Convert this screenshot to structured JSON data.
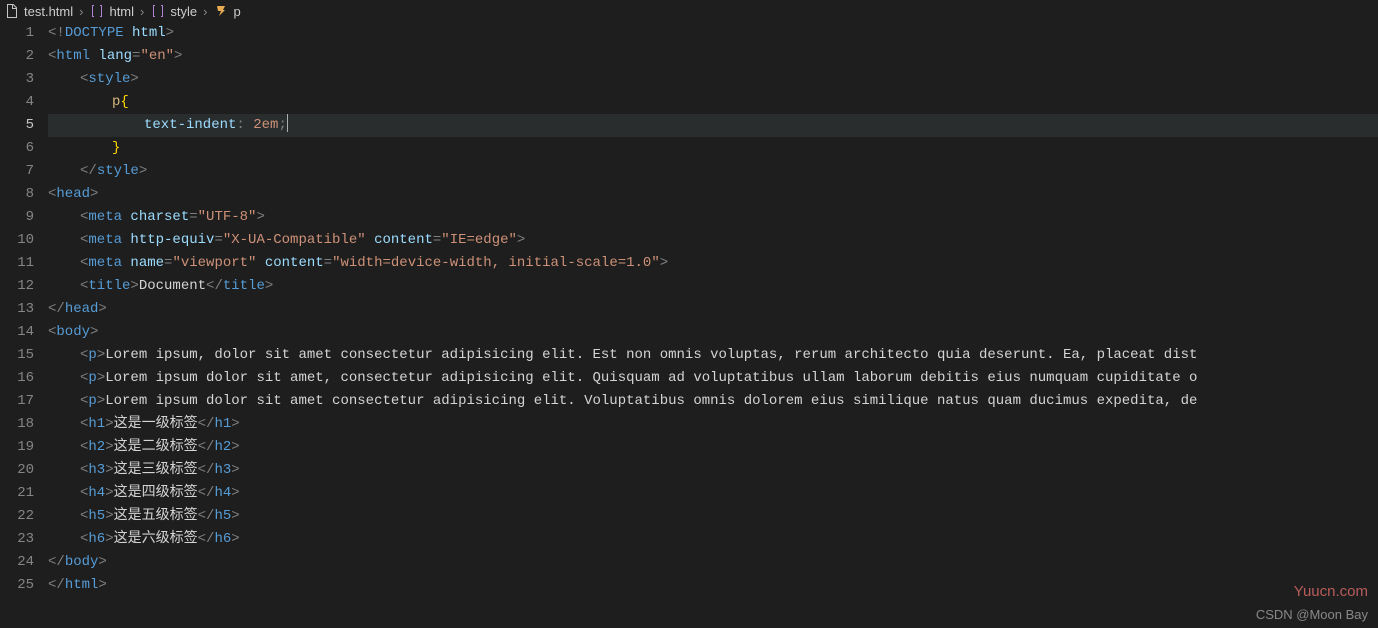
{
  "breadcrumb": [
    {
      "icon": "file",
      "label": "test.html"
    },
    {
      "icon": "brackets",
      "label": "html"
    },
    {
      "icon": "brackets",
      "label": "style"
    },
    {
      "icon": "symbol",
      "label": "p"
    }
  ],
  "activeLine": 5,
  "lines": [
    {
      "n": 1,
      "indent": 0,
      "seg": [
        [
          "c-gray",
          "<!"
        ],
        [
          "c-tag",
          "DOCTYPE"
        ],
        [
          "c-attr",
          " html"
        ],
        [
          "c-gray",
          ">"
        ]
      ]
    },
    {
      "n": 2,
      "indent": 0,
      "seg": [
        [
          "c-gray",
          "<"
        ],
        [
          "c-tag",
          "html"
        ],
        [
          "c-attr",
          " lang"
        ],
        [
          "c-gray",
          "="
        ],
        [
          "c-str",
          "\"en\""
        ],
        [
          "c-gray",
          ">"
        ]
      ]
    },
    {
      "n": 3,
      "indent": 1,
      "seg": [
        [
          "c-gray",
          "<"
        ],
        [
          "c-tag",
          "style"
        ],
        [
          "c-gray",
          ">"
        ]
      ]
    },
    {
      "n": 4,
      "indent": 2,
      "seg": [
        [
          "c-sel",
          "p"
        ],
        [
          "c-brace",
          "{"
        ]
      ]
    },
    {
      "n": 5,
      "indent": 3,
      "hl": true,
      "seg": [
        [
          "c-prop",
          "text-indent"
        ],
        [
          "c-gray",
          ": "
        ],
        [
          "c-val",
          "2em"
        ],
        [
          "c-gray",
          ";"
        ]
      ],
      "cursor": true
    },
    {
      "n": 6,
      "indent": 2,
      "seg": [
        [
          "c-brace",
          "}"
        ]
      ]
    },
    {
      "n": 7,
      "indent": 1,
      "seg": [
        [
          "c-gray",
          "</"
        ],
        [
          "c-tag",
          "style"
        ],
        [
          "c-gray",
          ">"
        ]
      ]
    },
    {
      "n": 8,
      "indent": 0,
      "seg": [
        [
          "c-gray",
          "<"
        ],
        [
          "c-tag",
          "head"
        ],
        [
          "c-gray",
          ">"
        ]
      ]
    },
    {
      "n": 9,
      "indent": 1,
      "seg": [
        [
          "c-gray",
          "<"
        ],
        [
          "c-tag",
          "meta"
        ],
        [
          "c-attr",
          " charset"
        ],
        [
          "c-gray",
          "="
        ],
        [
          "c-str",
          "\"UTF-8\""
        ],
        [
          "c-gray",
          ">"
        ]
      ]
    },
    {
      "n": 10,
      "indent": 1,
      "seg": [
        [
          "c-gray",
          "<"
        ],
        [
          "c-tag",
          "meta"
        ],
        [
          "c-attr",
          " http-equiv"
        ],
        [
          "c-gray",
          "="
        ],
        [
          "c-str",
          "\"X-UA-Compatible\""
        ],
        [
          "c-attr",
          " content"
        ],
        [
          "c-gray",
          "="
        ],
        [
          "c-str",
          "\"IE=edge\""
        ],
        [
          "c-gray",
          ">"
        ]
      ]
    },
    {
      "n": 11,
      "indent": 1,
      "seg": [
        [
          "c-gray",
          "<"
        ],
        [
          "c-tag",
          "meta"
        ],
        [
          "c-attr",
          " name"
        ],
        [
          "c-gray",
          "="
        ],
        [
          "c-str",
          "\"viewport\""
        ],
        [
          "c-attr",
          " content"
        ],
        [
          "c-gray",
          "="
        ],
        [
          "c-str",
          "\"width=device-width, initial-scale=1.0\""
        ],
        [
          "c-gray",
          ">"
        ]
      ]
    },
    {
      "n": 12,
      "indent": 1,
      "seg": [
        [
          "c-gray",
          "<"
        ],
        [
          "c-tag",
          "title"
        ],
        [
          "c-gray",
          ">"
        ],
        [
          "c-text",
          "Document"
        ],
        [
          "c-gray",
          "</"
        ],
        [
          "c-tag",
          "title"
        ],
        [
          "c-gray",
          ">"
        ]
      ]
    },
    {
      "n": 13,
      "indent": 0,
      "seg": [
        [
          "c-gray",
          "</"
        ],
        [
          "c-tag",
          "head"
        ],
        [
          "c-gray",
          ">"
        ]
      ]
    },
    {
      "n": 14,
      "indent": 0,
      "seg": [
        [
          "c-gray",
          "<"
        ],
        [
          "c-tag",
          "body"
        ],
        [
          "c-gray",
          ">"
        ]
      ]
    },
    {
      "n": 15,
      "indent": 1,
      "seg": [
        [
          "c-gray",
          "<"
        ],
        [
          "c-tag",
          "p"
        ],
        [
          "c-gray",
          ">"
        ],
        [
          "c-text",
          "Lorem ipsum, dolor sit amet consectetur adipisicing elit. Est non omnis voluptas, rerum architecto quia deserunt. Ea, placeat dist"
        ]
      ]
    },
    {
      "n": 16,
      "indent": 1,
      "seg": [
        [
          "c-gray",
          "<"
        ],
        [
          "c-tag",
          "p"
        ],
        [
          "c-gray",
          ">"
        ],
        [
          "c-text",
          "Lorem ipsum dolor sit amet, consectetur adipisicing elit. Quisquam ad voluptatibus ullam laborum debitis eius numquam cupiditate o"
        ]
      ]
    },
    {
      "n": 17,
      "indent": 1,
      "seg": [
        [
          "c-gray",
          "<"
        ],
        [
          "c-tag",
          "p"
        ],
        [
          "c-gray",
          ">"
        ],
        [
          "c-text",
          "Lorem ipsum dolor sit amet consectetur adipisicing elit. Voluptatibus omnis dolorem eius similique natus quam ducimus expedita, de"
        ]
      ]
    },
    {
      "n": 18,
      "indent": 1,
      "seg": [
        [
          "c-gray",
          "<"
        ],
        [
          "c-tag",
          "h1"
        ],
        [
          "c-gray",
          ">"
        ],
        [
          "c-text",
          "这是一级标签"
        ],
        [
          "c-gray",
          "</"
        ],
        [
          "c-tag",
          "h1"
        ],
        [
          "c-gray",
          ">"
        ]
      ]
    },
    {
      "n": 19,
      "indent": 1,
      "seg": [
        [
          "c-gray",
          "<"
        ],
        [
          "c-tag",
          "h2"
        ],
        [
          "c-gray",
          ">"
        ],
        [
          "c-text",
          "这是二级标签"
        ],
        [
          "c-gray",
          "</"
        ],
        [
          "c-tag",
          "h2"
        ],
        [
          "c-gray",
          ">"
        ]
      ]
    },
    {
      "n": 20,
      "indent": 1,
      "seg": [
        [
          "c-gray",
          "<"
        ],
        [
          "c-tag",
          "h3"
        ],
        [
          "c-gray",
          ">"
        ],
        [
          "c-text",
          "这是三级标签"
        ],
        [
          "c-gray",
          "</"
        ],
        [
          "c-tag",
          "h3"
        ],
        [
          "c-gray",
          ">"
        ]
      ]
    },
    {
      "n": 21,
      "indent": 1,
      "seg": [
        [
          "c-gray",
          "<"
        ],
        [
          "c-tag",
          "h4"
        ],
        [
          "c-gray",
          ">"
        ],
        [
          "c-text",
          "这是四级标签"
        ],
        [
          "c-gray",
          "</"
        ],
        [
          "c-tag",
          "h4"
        ],
        [
          "c-gray",
          ">"
        ]
      ]
    },
    {
      "n": 22,
      "indent": 1,
      "seg": [
        [
          "c-gray",
          "<"
        ],
        [
          "c-tag",
          "h5"
        ],
        [
          "c-gray",
          ">"
        ],
        [
          "c-text",
          "这是五级标签"
        ],
        [
          "c-gray",
          "</"
        ],
        [
          "c-tag",
          "h5"
        ],
        [
          "c-gray",
          ">"
        ]
      ]
    },
    {
      "n": 23,
      "indent": 1,
      "seg": [
        [
          "c-gray",
          "<"
        ],
        [
          "c-tag",
          "h6"
        ],
        [
          "c-gray",
          ">"
        ],
        [
          "c-text",
          "这是六级标签"
        ],
        [
          "c-gray",
          "</"
        ],
        [
          "c-tag",
          "h6"
        ],
        [
          "c-gray",
          ">"
        ]
      ]
    },
    {
      "n": 24,
      "indent": 0,
      "seg": [
        [
          "c-gray",
          "</"
        ],
        [
          "c-tag",
          "body"
        ],
        [
          "c-gray",
          ">"
        ]
      ]
    },
    {
      "n": 25,
      "indent": 0,
      "seg": [
        [
          "c-gray",
          "</"
        ],
        [
          "c-tag",
          "html"
        ],
        [
          "c-gray",
          ">"
        ]
      ]
    }
  ],
  "watermark1": "Yuucn.com",
  "watermark2": "CSDN @Moon Bay"
}
